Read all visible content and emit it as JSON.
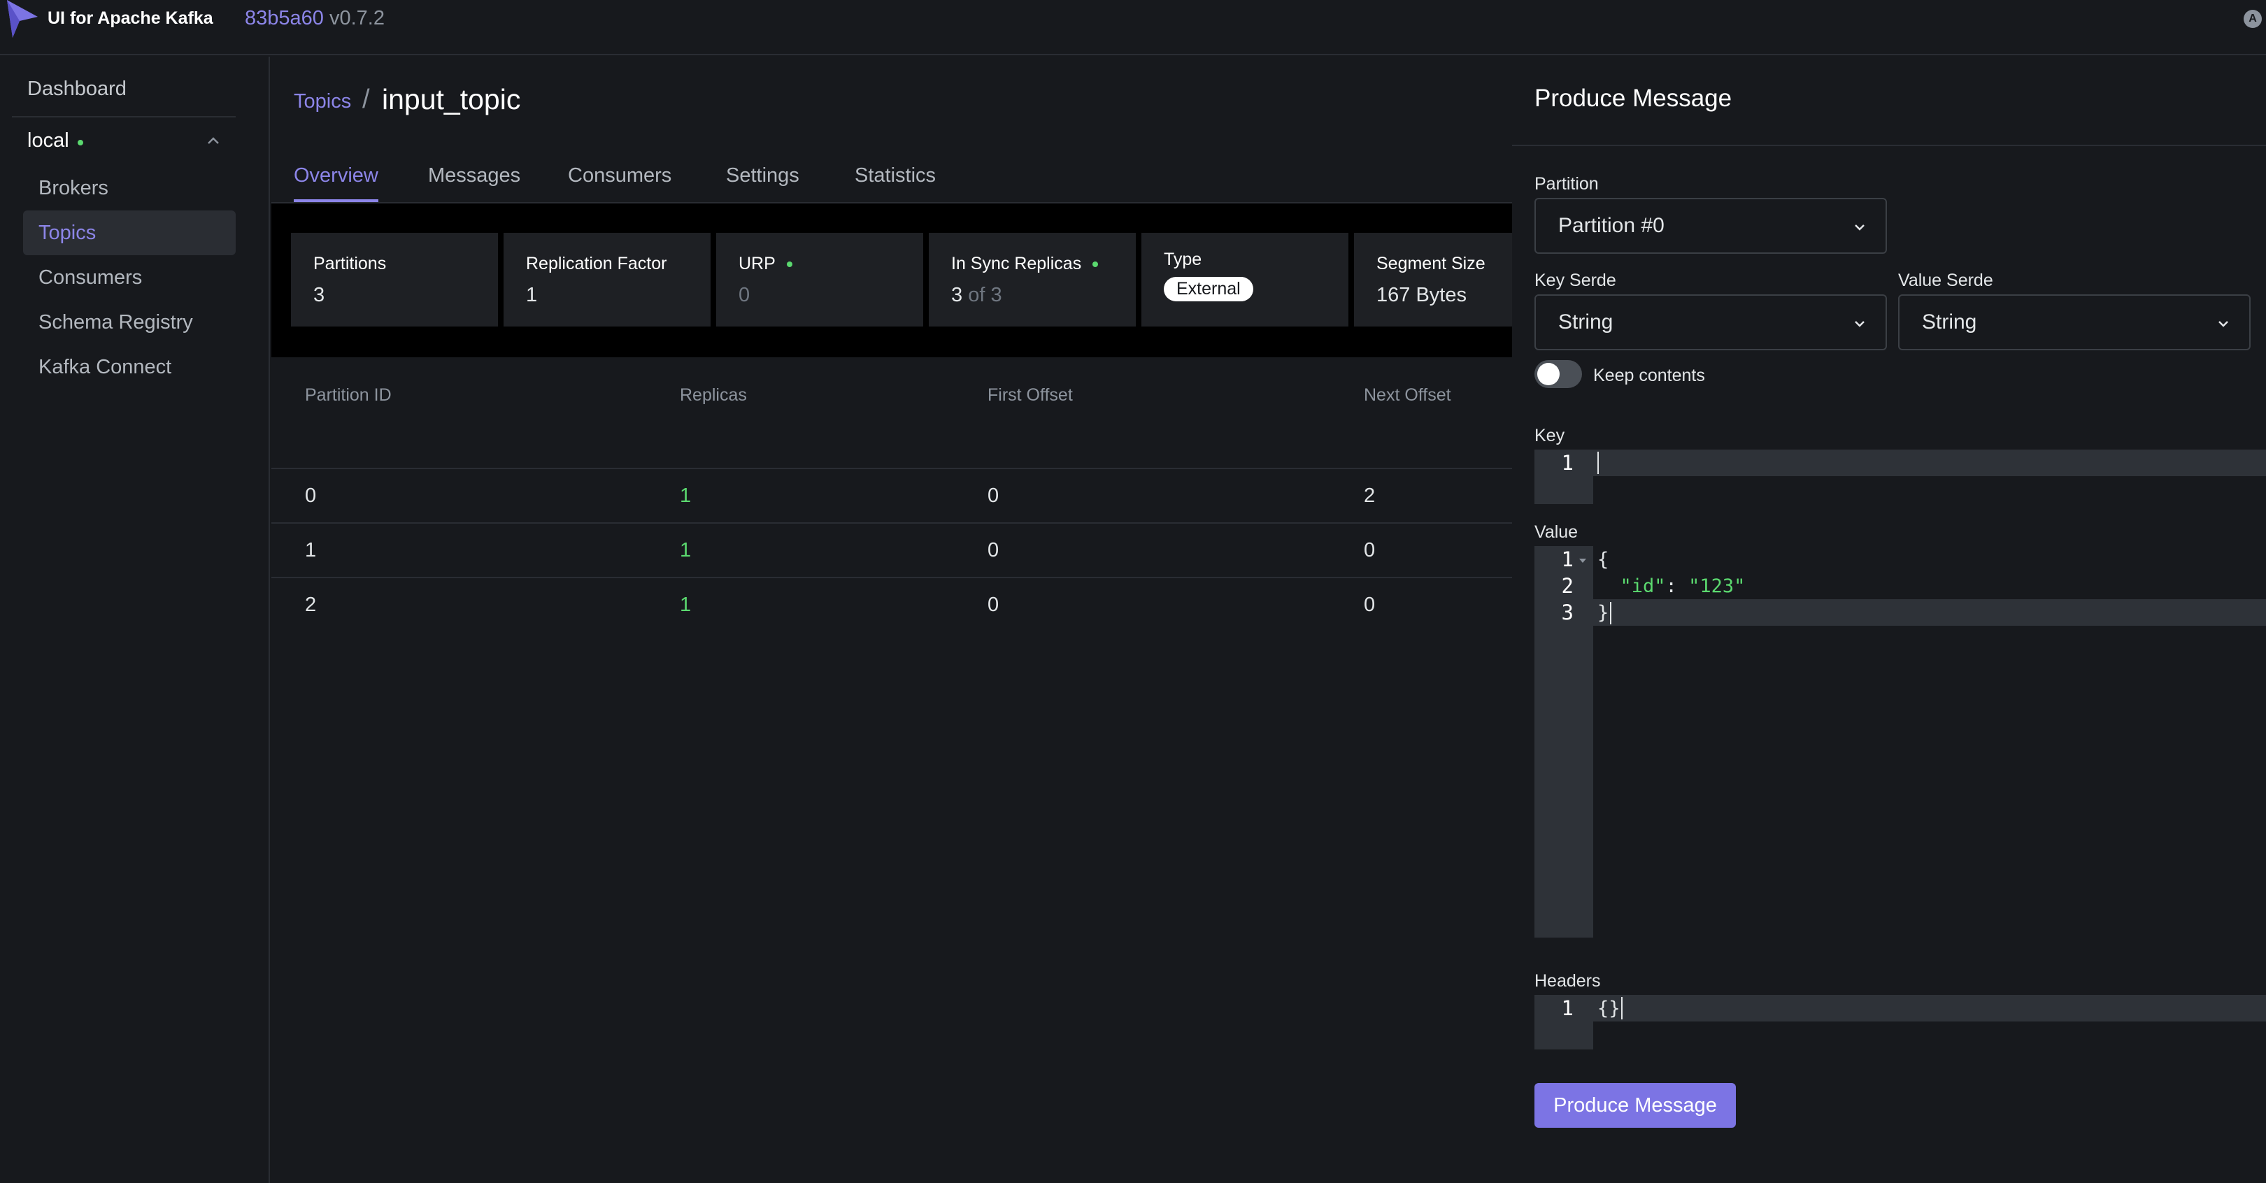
{
  "topnav": {
    "app_title": "UI for Apache Kafka",
    "commit": "83b5a60",
    "version": "v0.7.2",
    "avatar_letter": "A",
    "brand_color": "#8c85e8"
  },
  "sidebar": {
    "dashboard": "Dashboard",
    "cluster_name": "local",
    "items": [
      {
        "label": "Brokers",
        "active": false
      },
      {
        "label": "Topics",
        "active": true
      },
      {
        "label": "Consumers",
        "active": false
      },
      {
        "label": "Schema Registry",
        "active": false
      },
      {
        "label": "Kafka Connect",
        "active": false
      }
    ]
  },
  "main": {
    "breadcrumb": {
      "link": "Topics",
      "separator": "/",
      "current": "input_topic"
    },
    "tabs": [
      {
        "label": "Overview",
        "active": true
      },
      {
        "label": "Messages",
        "active": false
      },
      {
        "label": "Consumers",
        "active": false
      },
      {
        "label": "Settings",
        "active": false
      },
      {
        "label": "Statistics",
        "active": false
      }
    ],
    "stats": {
      "partitions": {
        "label": "Partitions",
        "value": "3"
      },
      "replication_factor": {
        "label": "Replication Factor",
        "value": "1"
      },
      "urp": {
        "label": "URP",
        "value": "0"
      },
      "in_sync_replicas": {
        "label": "In Sync Replicas",
        "value": "3",
        "suffix": "of 3"
      },
      "type": {
        "label": "Type",
        "value": "External"
      },
      "segment_size": {
        "label": "Segment Size",
        "value": "167 Bytes"
      }
    },
    "table": {
      "headers": [
        "Partition ID",
        "Replicas",
        "First Offset",
        "Next Offset"
      ],
      "rows": [
        [
          "0",
          "1",
          "0",
          "2"
        ],
        [
          "1",
          "1",
          "0",
          "0"
        ],
        [
          "2",
          "1",
          "0",
          "0"
        ]
      ]
    }
  },
  "produce": {
    "title": "Produce Message",
    "partition": {
      "label": "Partition",
      "value": "Partition #0"
    },
    "key_serde": {
      "label": "Key Serde",
      "value": "String"
    },
    "value_serde": {
      "label": "Value Serde",
      "value": "String"
    },
    "keep_contents": {
      "label": "Keep contents",
      "on": false
    },
    "key": {
      "label": "Key",
      "lines": [
        "1"
      ],
      "code": [
        ""
      ]
    },
    "value": {
      "label": "Value",
      "lines": [
        "1",
        "2",
        "3"
      ],
      "code": [
        "{",
        "  \"id\": \"123\"",
        "}"
      ],
      "id_key": "\"id\"",
      "id_sep": ": ",
      "id_value": "\"123\""
    },
    "headers": {
      "label": "Headers",
      "lines": [
        "1"
      ],
      "code": [
        "{}"
      ]
    },
    "submit_label": "Produce Message"
  }
}
